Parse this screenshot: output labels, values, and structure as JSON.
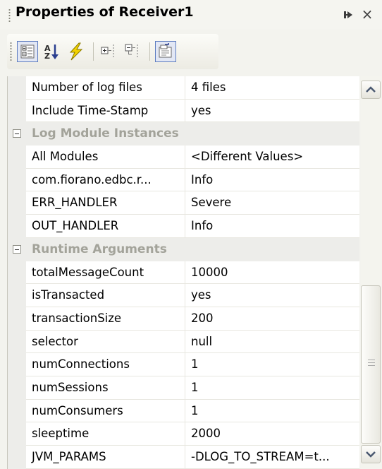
{
  "window": {
    "title": "Properties of Receiver1",
    "close_glyph": "×"
  },
  "toolbar": {
    "buttons": [
      {
        "icon": "categorized-icon",
        "pressed": true
      },
      {
        "icon": "alphabetical-sort-icon",
        "pressed": false
      },
      {
        "icon": "events-icon",
        "pressed": false
      },
      {
        "icon": "expand-all-icon",
        "pressed": false
      },
      {
        "icon": "collapse-all-icon",
        "pressed": false
      },
      {
        "icon": "property-pages-icon",
        "pressed": true
      }
    ]
  },
  "grid": {
    "rows": [
      {
        "kind": "prop",
        "name": "Number of log files",
        "value": "4 files"
      },
      {
        "kind": "prop",
        "name": "Include Time-Stamp",
        "value": "yes"
      },
      {
        "kind": "cat",
        "name": "Log Module Instances"
      },
      {
        "kind": "prop",
        "name": "All Modules",
        "value": "<Different Values>"
      },
      {
        "kind": "prop",
        "name": "com.fiorano.edbc.r...",
        "value": "Info"
      },
      {
        "kind": "prop",
        "name": "ERR_HANDLER",
        "value": "Severe"
      },
      {
        "kind": "prop",
        "name": "OUT_HANDLER",
        "value": "Info"
      },
      {
        "kind": "cat",
        "name": "Runtime Arguments"
      },
      {
        "kind": "prop",
        "name": "totalMessageCount",
        "value": "10000"
      },
      {
        "kind": "prop",
        "name": "isTransacted",
        "value": "yes"
      },
      {
        "kind": "prop",
        "name": "transactionSize",
        "value": "200"
      },
      {
        "kind": "prop",
        "name": "selector",
        "value": "null"
      },
      {
        "kind": "prop",
        "name": "numConnections",
        "value": "1"
      },
      {
        "kind": "prop",
        "name": "numSessions",
        "value": "1"
      },
      {
        "kind": "prop",
        "name": "numConsumers",
        "value": "1"
      },
      {
        "kind": "prop",
        "name": "sleeptime",
        "value": "2000"
      },
      {
        "kind": "prop",
        "name": "JVM_PARAMS",
        "value": "-DLOG_TO_STREAM=t..."
      }
    ]
  },
  "colors": {
    "category_text": "#a3a39a",
    "pressed_border": "#5d7cc0",
    "lightning": "#f2d200"
  }
}
